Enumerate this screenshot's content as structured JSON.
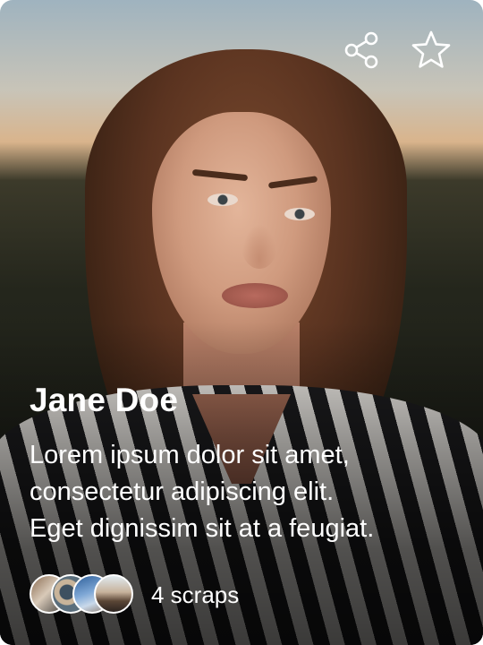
{
  "profile": {
    "name": "Jane Doe",
    "description_lines": [
      "Lorem ipsum dolor sit amet,",
      "consectetur adipiscing elit.",
      "Eget dignissim sit at a feugiat."
    ],
    "scraps_label": "4 scraps"
  },
  "actions": {
    "share_icon": "share-icon",
    "favorite_icon": "star-outline-icon"
  },
  "colors": {
    "text": "#FFFFFF",
    "overlay": "#000000"
  }
}
